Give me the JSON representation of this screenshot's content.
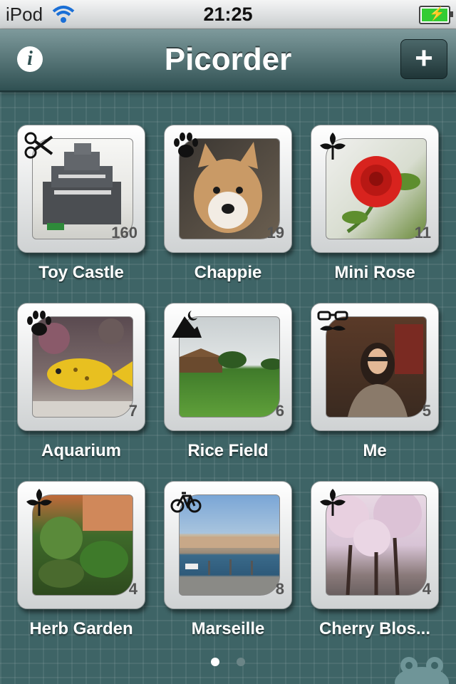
{
  "status_bar": {
    "device": "iPod",
    "time": "21:25"
  },
  "nav": {
    "title": "Picorder",
    "info_label": "i",
    "add_label": "+"
  },
  "albums": [
    {
      "name": "Toy Castle",
      "count": "160",
      "icon": "scissors-icon"
    },
    {
      "name": "Chappie",
      "count": "19",
      "icon": "paw-icon"
    },
    {
      "name": "Mini Rose",
      "count": "11",
      "icon": "leaf-icon"
    },
    {
      "name": "Aquarium",
      "count": "7",
      "icon": "paw-icon"
    },
    {
      "name": "Rice Field",
      "count": "6",
      "icon": "mountain-moon-icon"
    },
    {
      "name": "Me",
      "count": "5",
      "icon": "glasses-mustache-icon"
    },
    {
      "name": "Herb Garden",
      "count": "4",
      "icon": "leaf-icon"
    },
    {
      "name": "Marseille",
      "count": "8",
      "icon": "bicycle-icon"
    },
    {
      "name": "Cherry Blos...",
      "count": "4",
      "icon": "leaf-icon"
    }
  ],
  "pager": {
    "pages": 2,
    "current": 1
  },
  "colors": {
    "background": "#3e6466",
    "navbar": "#2f5052",
    "battery": "#33cc33"
  }
}
